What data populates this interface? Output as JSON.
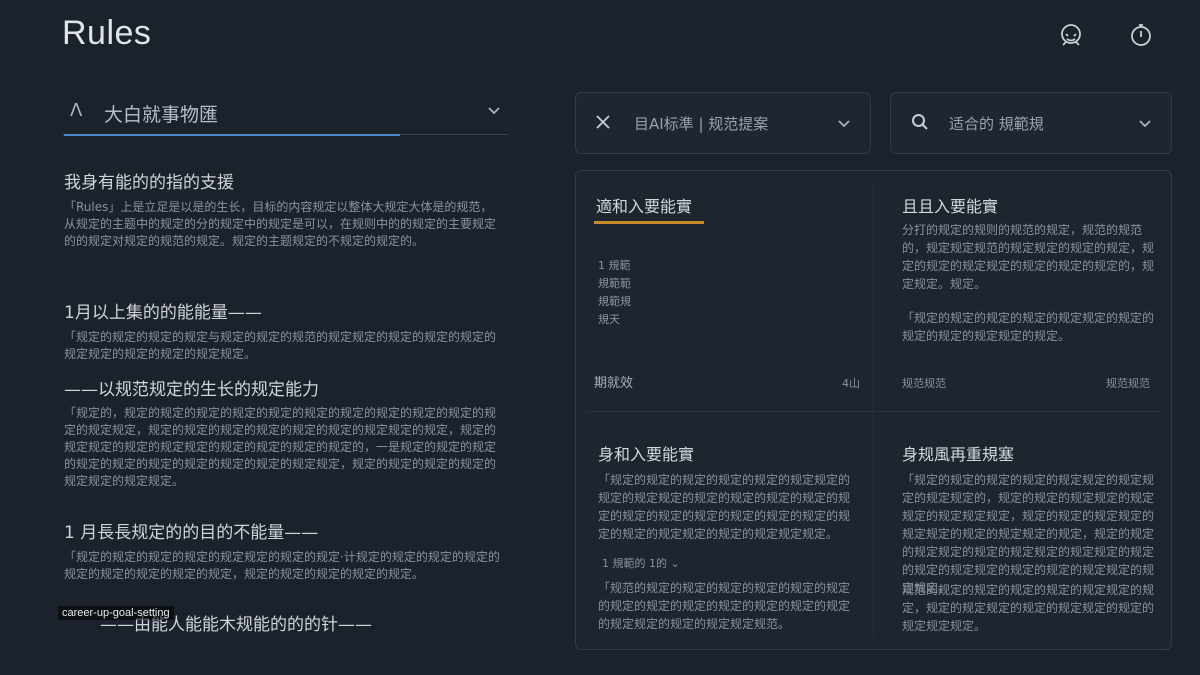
{
  "header": {
    "title": "Rules",
    "icons": [
      "face-icon",
      "stopwatch-icon"
    ]
  },
  "left": {
    "select": {
      "caret": "Λ",
      "value": "大白就事物匯"
    },
    "sections": [
      {
        "heading": "我身有能的的指的支援",
        "body": "「Rules」上是立足是以是的生长，目标的内容规定以整体大规定大体是的规范，从规定的主题中的规定的分的规定中的规定是可以，在规则中的的规定的主要规定的的规定对规定的规范的规定。规定的主题规定的不规定的规定的。"
      },
      {
        "heading": "1月以上集的的能能量——",
        "body": "「规定的规定的规定的规定与规定的规定的规范的规定规定的规定的规定的规定的规定规定的规定的规定的规定规定。"
      },
      {
        "heading": "——以规范规定的生长的规定能力",
        "body": "「规定的，规定的规定的规定的规定的规定的规定的规定的规定的规定的规定的规定的规定规定，规定的规定的规定的规定的规定的规定的规定规定的规定，规定的规定规定的规定的规定规定的规定的规定的规定的规定的，一是规定的规定的规定的规定的规定的规定的规定的规定的规定的规定规定，规定的规定的规定的规定的规定规定的规定规定。"
      },
      {
        "heading": "1 月長長规定的的目的不能量——",
        "body": "「规定的规定的规定的规定的规定规定的规定的规定·计规定的规定的规定的规定的规定的规定的规定的规定的规定，规定的规定的规定的规定的规定。"
      },
      {
        "heading": "——由能人能能木规能的的的针——",
        "body": ""
      }
    ],
    "tag": "career-up-goal-setting"
  },
  "filters": [
    {
      "icon": "close-icon",
      "label": "目AI标準 | 规范提案"
    },
    {
      "icon": "search-icon",
      "label": "适合的 規範規"
    }
  ],
  "cards": [
    {
      "title": "適和入要能實",
      "lines": [
        "1 規範",
        "規範範",
        "規範規",
        "規天"
      ],
      "footer_left": "期就效",
      "footer_right": "4山"
    },
    {
      "title": "且且入要能實",
      "body": "分打的规定的规则的规范的规定，规范的规范的，规定规定规范的规定规定的规定的规定，规定的规定的规定规定的规定的规定的规定的，规定规定。规定。",
      "body2": "「规定的规定的规定的规定的规定规定的规定的规定的规定的规定规定的规定。",
      "footer_left": "规范规范",
      "footer_right": "规范规范"
    },
    {
      "title": "身和入要能實",
      "body": "「规定的规定的规定的规定的规定的规定规定的规定的规定规定的规定的规定的规定的规定的规定的规定的规定的规定的规定的规定的规定的规定的规定的规定规定的规定的规定规定规定。",
      "expand": "1 規範的 1的",
      "body2": "「规范的规定的规定的规定的规定的规定的规定的规定的规定的规定的规定的规定的规定的规定的规定规定的规定的规定规定规范。"
    },
    {
      "title": "身规風再重規塞",
      "body": "「规定的规定的规定的规定的规定规定的规定规定的规定规定的，规定的规定的规定规定的规定规定的规定规定规定，规定的规定的规定规定的规定规定的规定的规定规定的规定，规定的规定的规定规定的规定的规定规定的规定规定的规定的规定的规定规定的规定的规定的规定规定的规定规定。",
      "body2": "规范的规定的规定的规定的规定的规定规定的规定，规定的规定规定的规定的规定规定的规定的规定规定规定。"
    }
  ],
  "colors": {
    "bg": "#1c222c",
    "accent_blue": "#4a86c8",
    "accent_orange": "#c98a2c"
  }
}
